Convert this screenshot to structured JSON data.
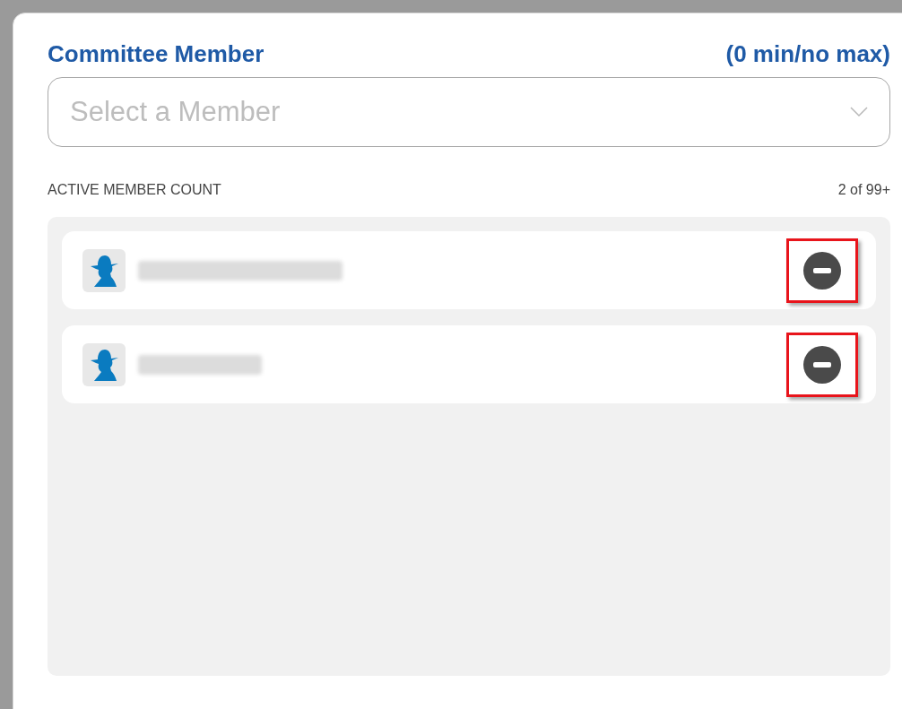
{
  "field": {
    "label": "Committee Member",
    "limits": "(0 min/no max)",
    "placeholder": "Select a Member"
  },
  "count": {
    "label": "ACTIVE MEMBER COUNT",
    "value": "2 of 99+"
  },
  "members": [
    {
      "name_redacted": true,
      "highlighted": true
    },
    {
      "name_redacted": true,
      "highlighted": true
    }
  ]
}
